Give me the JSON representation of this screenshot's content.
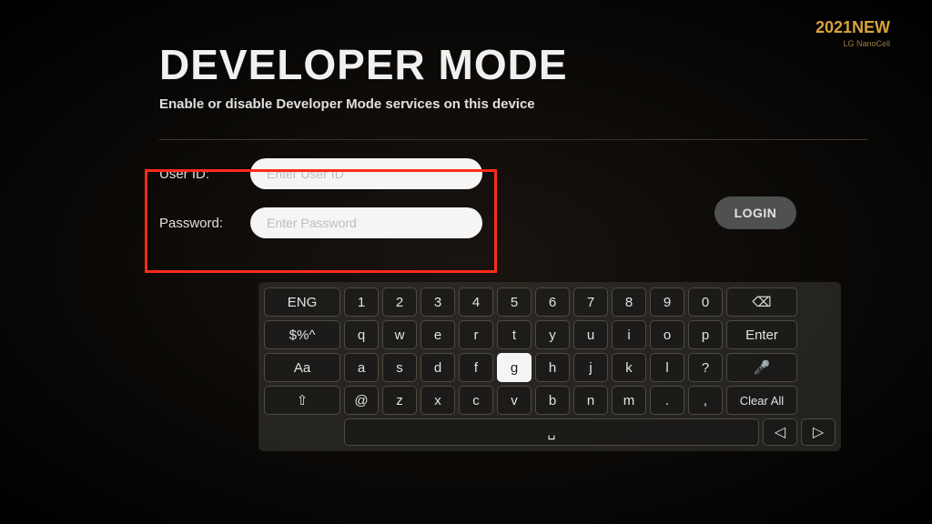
{
  "header": {
    "title": "DEVELOPER MODE",
    "subtitle": "Enable or disable Developer Mode services on this device"
  },
  "corner": {
    "year": "2021",
    "new": "NEW",
    "sub": "LG NanoCell"
  },
  "form": {
    "userid_label": "User ID:",
    "password_label": "Password:",
    "userid_placeholder": "Enter User ID",
    "password_placeholder": "Enter Password"
  },
  "login": {
    "label": "LOGIN"
  },
  "keyboard": {
    "left_col": [
      "ENG",
      "$%^",
      "Aa",
      "⇧"
    ],
    "row1": [
      "1",
      "2",
      "3",
      "4",
      "5",
      "6",
      "7",
      "8",
      "9",
      "0"
    ],
    "row2": [
      "q",
      "w",
      "e",
      "r",
      "t",
      "y",
      "u",
      "i",
      "o",
      "p"
    ],
    "row3": [
      "a",
      "s",
      "d",
      "f",
      "g",
      "h",
      "j",
      "k",
      "l",
      "?"
    ],
    "row4": [
      "@",
      "z",
      "x",
      "c",
      "v",
      "b",
      "n",
      "m",
      ".",
      ","
    ],
    "right_col": [
      "⌫",
      "Enter",
      "🎤",
      "Clear All"
    ],
    "selected_key": "g",
    "space_label": "␣",
    "nav_left": "◁",
    "nav_right": "▷"
  }
}
